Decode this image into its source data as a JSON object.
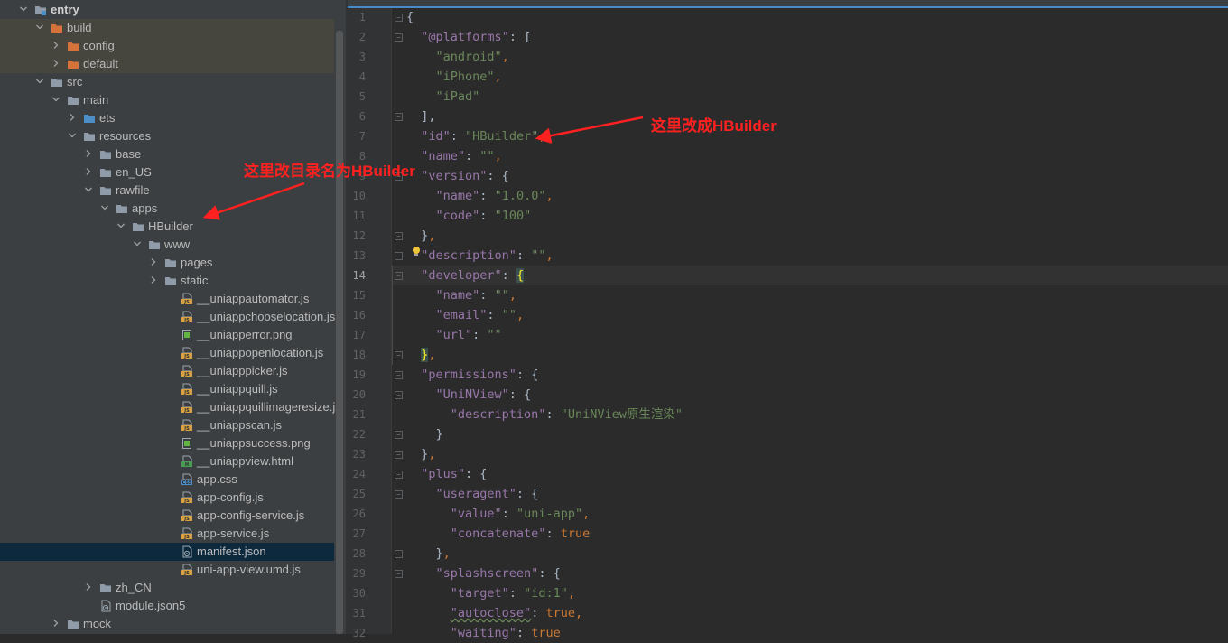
{
  "project_tree": [
    {
      "label": "entry",
      "depth": 0,
      "expanded": true,
      "type": "folder-module",
      "bold": true
    },
    {
      "label": "build",
      "depth": 1,
      "expanded": true,
      "type": "folder-orange"
    },
    {
      "label": "config",
      "depth": 2,
      "expanded": false,
      "type": "folder-orange"
    },
    {
      "label": "default",
      "depth": 2,
      "expanded": false,
      "type": "folder-orange"
    },
    {
      "label": "src",
      "depth": 1,
      "expanded": true,
      "type": "folder"
    },
    {
      "label": "main",
      "depth": 2,
      "expanded": true,
      "type": "folder"
    },
    {
      "label": "ets",
      "depth": 3,
      "expanded": false,
      "type": "folder-blue"
    },
    {
      "label": "resources",
      "depth": 3,
      "expanded": true,
      "type": "folder"
    },
    {
      "label": "base",
      "depth": 4,
      "expanded": false,
      "type": "folder"
    },
    {
      "label": "en_US",
      "depth": 4,
      "expanded": false,
      "type": "folder"
    },
    {
      "label": "rawfile",
      "depth": 4,
      "expanded": true,
      "type": "folder"
    },
    {
      "label": "apps",
      "depth": 5,
      "expanded": true,
      "type": "folder"
    },
    {
      "label": "HBuilder",
      "depth": 6,
      "expanded": true,
      "type": "folder"
    },
    {
      "label": "www",
      "depth": 7,
      "expanded": true,
      "type": "folder"
    },
    {
      "label": "pages",
      "depth": 8,
      "expanded": false,
      "type": "folder"
    },
    {
      "label": "static",
      "depth": 8,
      "expanded": false,
      "type": "folder"
    },
    {
      "label": "__uniappautomator.js",
      "depth": 9,
      "type": "js"
    },
    {
      "label": "__uniappchooselocation.js",
      "depth": 9,
      "type": "js"
    },
    {
      "label": "__uniapperror.png",
      "depth": 9,
      "type": "png"
    },
    {
      "label": "__uniappopenlocation.js",
      "depth": 9,
      "type": "js"
    },
    {
      "label": "__uniapppicker.js",
      "depth": 9,
      "type": "js"
    },
    {
      "label": "__uniappquill.js",
      "depth": 9,
      "type": "js"
    },
    {
      "label": "__uniappquillimageresize.js",
      "depth": 9,
      "type": "js"
    },
    {
      "label": "__uniappscan.js",
      "depth": 9,
      "type": "js"
    },
    {
      "label": "__uniappsuccess.png",
      "depth": 9,
      "type": "png"
    },
    {
      "label": "__uniappview.html",
      "depth": 9,
      "type": "html"
    },
    {
      "label": "app.css",
      "depth": 9,
      "type": "css"
    },
    {
      "label": "app-config.js",
      "depth": 9,
      "type": "js"
    },
    {
      "label": "app-config-service.js",
      "depth": 9,
      "type": "js"
    },
    {
      "label": "app-service.js",
      "depth": 9,
      "type": "js"
    },
    {
      "label": "manifest.json",
      "depth": 9,
      "type": "json",
      "selected": true
    },
    {
      "label": "uni-app-view.umd.js",
      "depth": 9,
      "type": "js"
    },
    {
      "label": "zh_CN",
      "depth": 4,
      "expanded": false,
      "type": "folder"
    },
    {
      "label": "module.json5",
      "depth": 4,
      "type": "json5"
    },
    {
      "label": "mock",
      "depth": 2,
      "expanded": false,
      "type": "folder"
    }
  ],
  "editor": {
    "current_line": "14",
    "lines": [
      {
        "n": "1",
        "fold": true,
        "tokens": [
          [
            "p",
            "{"
          ]
        ]
      },
      {
        "n": "2",
        "fold": true,
        "tokens": [
          [
            "p",
            "  "
          ],
          [
            "k",
            "\"@platforms\""
          ],
          [
            "p",
            ": ["
          ]
        ]
      },
      {
        "n": "3",
        "tokens": [
          [
            "p",
            "    "
          ],
          [
            "s",
            "\"android\""
          ],
          [
            "c",
            ","
          ]
        ]
      },
      {
        "n": "4",
        "tokens": [
          [
            "p",
            "    "
          ],
          [
            "s",
            "\"iPhone\""
          ],
          [
            "c",
            ","
          ]
        ]
      },
      {
        "n": "5",
        "tokens": [
          [
            "p",
            "    "
          ],
          [
            "s",
            "\"iPad\""
          ]
        ]
      },
      {
        "n": "6",
        "fold": true,
        "tokens": [
          [
            "p",
            "  ],"
          ]
        ]
      },
      {
        "n": "7",
        "tokens": [
          [
            "p",
            "  "
          ],
          [
            "k",
            "\"id\""
          ],
          [
            "p",
            ": "
          ],
          [
            "s",
            "\"HBuilder\""
          ],
          [
            "c",
            ","
          ]
        ]
      },
      {
        "n": "8",
        "tokens": [
          [
            "p",
            "  "
          ],
          [
            "k",
            "\"name\""
          ],
          [
            "p",
            ": "
          ],
          [
            "s",
            "\"\""
          ],
          [
            "c",
            ","
          ]
        ]
      },
      {
        "n": "9",
        "fold": true,
        "tokens": [
          [
            "p",
            "  "
          ],
          [
            "k",
            "\"version\""
          ],
          [
            "p",
            ": {"
          ]
        ]
      },
      {
        "n": "10",
        "tokens": [
          [
            "p",
            "    "
          ],
          [
            "k",
            "\"name\""
          ],
          [
            "p",
            ": "
          ],
          [
            "s",
            "\"1.0.0\""
          ],
          [
            "c",
            ","
          ]
        ]
      },
      {
        "n": "11",
        "tokens": [
          [
            "p",
            "    "
          ],
          [
            "k",
            "\"code\""
          ],
          [
            "p",
            ": "
          ],
          [
            "s",
            "\"100\""
          ]
        ]
      },
      {
        "n": "12",
        "fold": true,
        "tokens": [
          [
            "p",
            "  }"
          ],
          [
            "c",
            ","
          ]
        ]
      },
      {
        "n": "13",
        "fold": true,
        "tokens": [
          [
            "p",
            "  "
          ],
          [
            "k",
            "\"description\""
          ],
          [
            "p",
            ": "
          ],
          [
            "s",
            "\"\""
          ],
          [
            "c",
            ","
          ]
        ]
      },
      {
        "n": "14",
        "fold": true,
        "tokens": [
          [
            "p",
            "  "
          ],
          [
            "k",
            "\"developer\""
          ],
          [
            "p",
            ": "
          ],
          [
            "hl",
            "{"
          ]
        ]
      },
      {
        "n": "15",
        "tokens": [
          [
            "p",
            "    "
          ],
          [
            "k",
            "\"name\""
          ],
          [
            "p",
            ": "
          ],
          [
            "s",
            "\"\""
          ],
          [
            "c",
            ","
          ]
        ]
      },
      {
        "n": "16",
        "tokens": [
          [
            "p",
            "    "
          ],
          [
            "k",
            "\"email\""
          ],
          [
            "p",
            ": "
          ],
          [
            "s",
            "\"\""
          ],
          [
            "c",
            ","
          ]
        ]
      },
      {
        "n": "17",
        "tokens": [
          [
            "p",
            "    "
          ],
          [
            "k",
            "\"url\""
          ],
          [
            "p",
            ": "
          ],
          [
            "s",
            "\"\""
          ]
        ]
      },
      {
        "n": "18",
        "fold": true,
        "tokens": [
          [
            "p",
            "  "
          ],
          [
            "hl",
            "}"
          ],
          [
            "c",
            ","
          ]
        ]
      },
      {
        "n": "19",
        "fold": true,
        "tokens": [
          [
            "p",
            "  "
          ],
          [
            "k",
            "\"permissions\""
          ],
          [
            "p",
            ": {"
          ]
        ]
      },
      {
        "n": "20",
        "fold": true,
        "tokens": [
          [
            "p",
            "    "
          ],
          [
            "k",
            "\"UniNView\""
          ],
          [
            "p",
            ": {"
          ]
        ]
      },
      {
        "n": "21",
        "tokens": [
          [
            "p",
            "      "
          ],
          [
            "k",
            "\"description\""
          ],
          [
            "p",
            ": "
          ],
          [
            "s",
            "\"UniNView原生渲染\""
          ]
        ]
      },
      {
        "n": "22",
        "fold": true,
        "tokens": [
          [
            "p",
            "    }"
          ]
        ]
      },
      {
        "n": "23",
        "fold": true,
        "tokens": [
          [
            "p",
            "  }"
          ],
          [
            "c",
            ","
          ]
        ]
      },
      {
        "n": "24",
        "fold": true,
        "tokens": [
          [
            "p",
            "  "
          ],
          [
            "k",
            "\"plus\""
          ],
          [
            "p",
            ": {"
          ]
        ]
      },
      {
        "n": "25",
        "fold": true,
        "tokens": [
          [
            "p",
            "    "
          ],
          [
            "k",
            "\"useragent\""
          ],
          [
            "p",
            ": {"
          ]
        ]
      },
      {
        "n": "26",
        "tokens": [
          [
            "p",
            "      "
          ],
          [
            "k",
            "\"value\""
          ],
          [
            "p",
            ": "
          ],
          [
            "s",
            "\"uni-app\""
          ],
          [
            "c",
            ","
          ]
        ]
      },
      {
        "n": "27",
        "tokens": [
          [
            "p",
            "      "
          ],
          [
            "k",
            "\"concatenate\""
          ],
          [
            "p",
            ": "
          ],
          [
            "b",
            "true"
          ]
        ]
      },
      {
        "n": "28",
        "fold": true,
        "tokens": [
          [
            "p",
            "    }"
          ],
          [
            "c",
            ","
          ]
        ]
      },
      {
        "n": "29",
        "fold": true,
        "tokens": [
          [
            "p",
            "    "
          ],
          [
            "k",
            "\"splashscreen\""
          ],
          [
            "p",
            ": {"
          ]
        ]
      },
      {
        "n": "30",
        "tokens": [
          [
            "p",
            "      "
          ],
          [
            "k",
            "\"target\""
          ],
          [
            "p",
            ": "
          ],
          [
            "s",
            "\"id:1\""
          ],
          [
            "c",
            ","
          ]
        ]
      },
      {
        "n": "31",
        "tokens": [
          [
            "p",
            "      "
          ],
          [
            "sq",
            "\"autoclose\""
          ],
          [
            "p",
            ": "
          ],
          [
            "b",
            "true"
          ],
          [
            "c",
            ","
          ]
        ]
      },
      {
        "n": "32",
        "tokens": [
          [
            "p",
            "      "
          ],
          [
            "k",
            "\"waiting\""
          ],
          [
            "p",
            ": "
          ],
          [
            "b",
            "true"
          ]
        ]
      }
    ]
  },
  "annotations": {
    "rename_dir": "这里改目录名为HBuilder",
    "change_id": "这里改成HBuilder"
  },
  "colors": {
    "annotation": "#ff2020",
    "folder": "#8f9ba8",
    "folder_orange": "#d6733a",
    "folder_blue": "#4b8ec8",
    "selection": "#0d293e"
  }
}
